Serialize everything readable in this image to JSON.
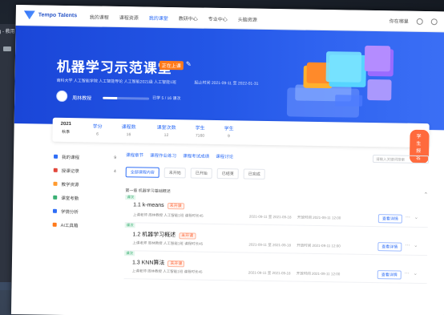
{
  "bg_window": {
    "title": "g - 教用"
  },
  "nav": {
    "logo_text": "Tempo Talents",
    "items": [
      "我的课程",
      "课程资源",
      "我的课堂",
      "教研中心",
      "专业中心",
      "头脑资源"
    ],
    "active_index": 2,
    "user": "你在哪里"
  },
  "hero": {
    "title": "机器学习示范课堂",
    "tag": "正在上课",
    "meta": "南科大学  人工智能学院  人工智能导论  人工智能2021级  人工智能1班",
    "meta2": "起止时间  2021-09-11 至 2022-01-31",
    "teacher": "周林教授",
    "progress_text": "已学 5 / 16 课次",
    "progress": 0.31
  },
  "stats": {
    "year": {
      "label": "2021",
      "value": "秋季"
    },
    "items": [
      {
        "label": "学分",
        "value": "6"
      },
      {
        "label": "课程数",
        "value": "16"
      },
      {
        "label": "课堂次数",
        "value": "12"
      },
      {
        "label": "学生",
        "value": "7160"
      },
      {
        "label": "学生",
        "value": "9"
      }
    ],
    "enroll_label": "学生报名"
  },
  "sidebar": {
    "items": [
      {
        "label": "我的课程",
        "count": "9",
        "color": "#2f6ef6"
      },
      {
        "label": "授课记录",
        "count": "4",
        "color": "#e2473b"
      },
      {
        "label": "教学资源",
        "count": "",
        "color": "#ff9a2e"
      },
      {
        "label": "课堂考勤",
        "count": "",
        "color": "#3ab074"
      },
      {
        "label": "学情分析",
        "count": "",
        "color": "#2f6ef6"
      },
      {
        "label": "AI工具箱",
        "count": "",
        "color": "#ff7a1a"
      }
    ]
  },
  "content": {
    "tabs": [
      "课程章节",
      "课程作业练习",
      "课程考试成绩",
      "课程讨论"
    ],
    "search_placeholder": "请输入关键词搜索",
    "filters": [
      "全部课程内容",
      "未开始",
      "已开始",
      "已结束",
      "已完成"
    ],
    "active_filter": 0,
    "section_title": "第一章 机器学习基础概述",
    "lessons": [
      {
        "label": "课次",
        "name": "1.1 k-means",
        "badge": "未开课",
        "sub": "上课老师 周林教授 人工智能1班 课程时长45",
        "sub2": "2021-09-11 至 2021-09-18",
        "sub3": "开放时间 2021-09-11 12:00",
        "action": "查看详情"
      },
      {
        "label": "课次",
        "name": "1.2 机器学习概述",
        "badge": "未开课",
        "sub": "上课老师 周林教授 人工智能1班 课程时长45",
        "sub2": "2021-09-11 至 2021-09-18",
        "sub3": "开放时间 2021-09-11 12:00",
        "action": "查看详情"
      },
      {
        "label": "课次",
        "name": "1.3 KNN算法",
        "badge": "未开课",
        "sub": "上课老师 周林教授 人工智能1班 课程时长45",
        "sub2": "2021-09-11 至 2021-09-18",
        "sub3": "开放时间 2021-09-11 12:00",
        "action": "查看详情"
      }
    ]
  },
  "colors": {
    "accent": "#2f6ef6",
    "hero": "#2356e6",
    "orange": "#ff6a3d",
    "green": "#3ab074"
  }
}
